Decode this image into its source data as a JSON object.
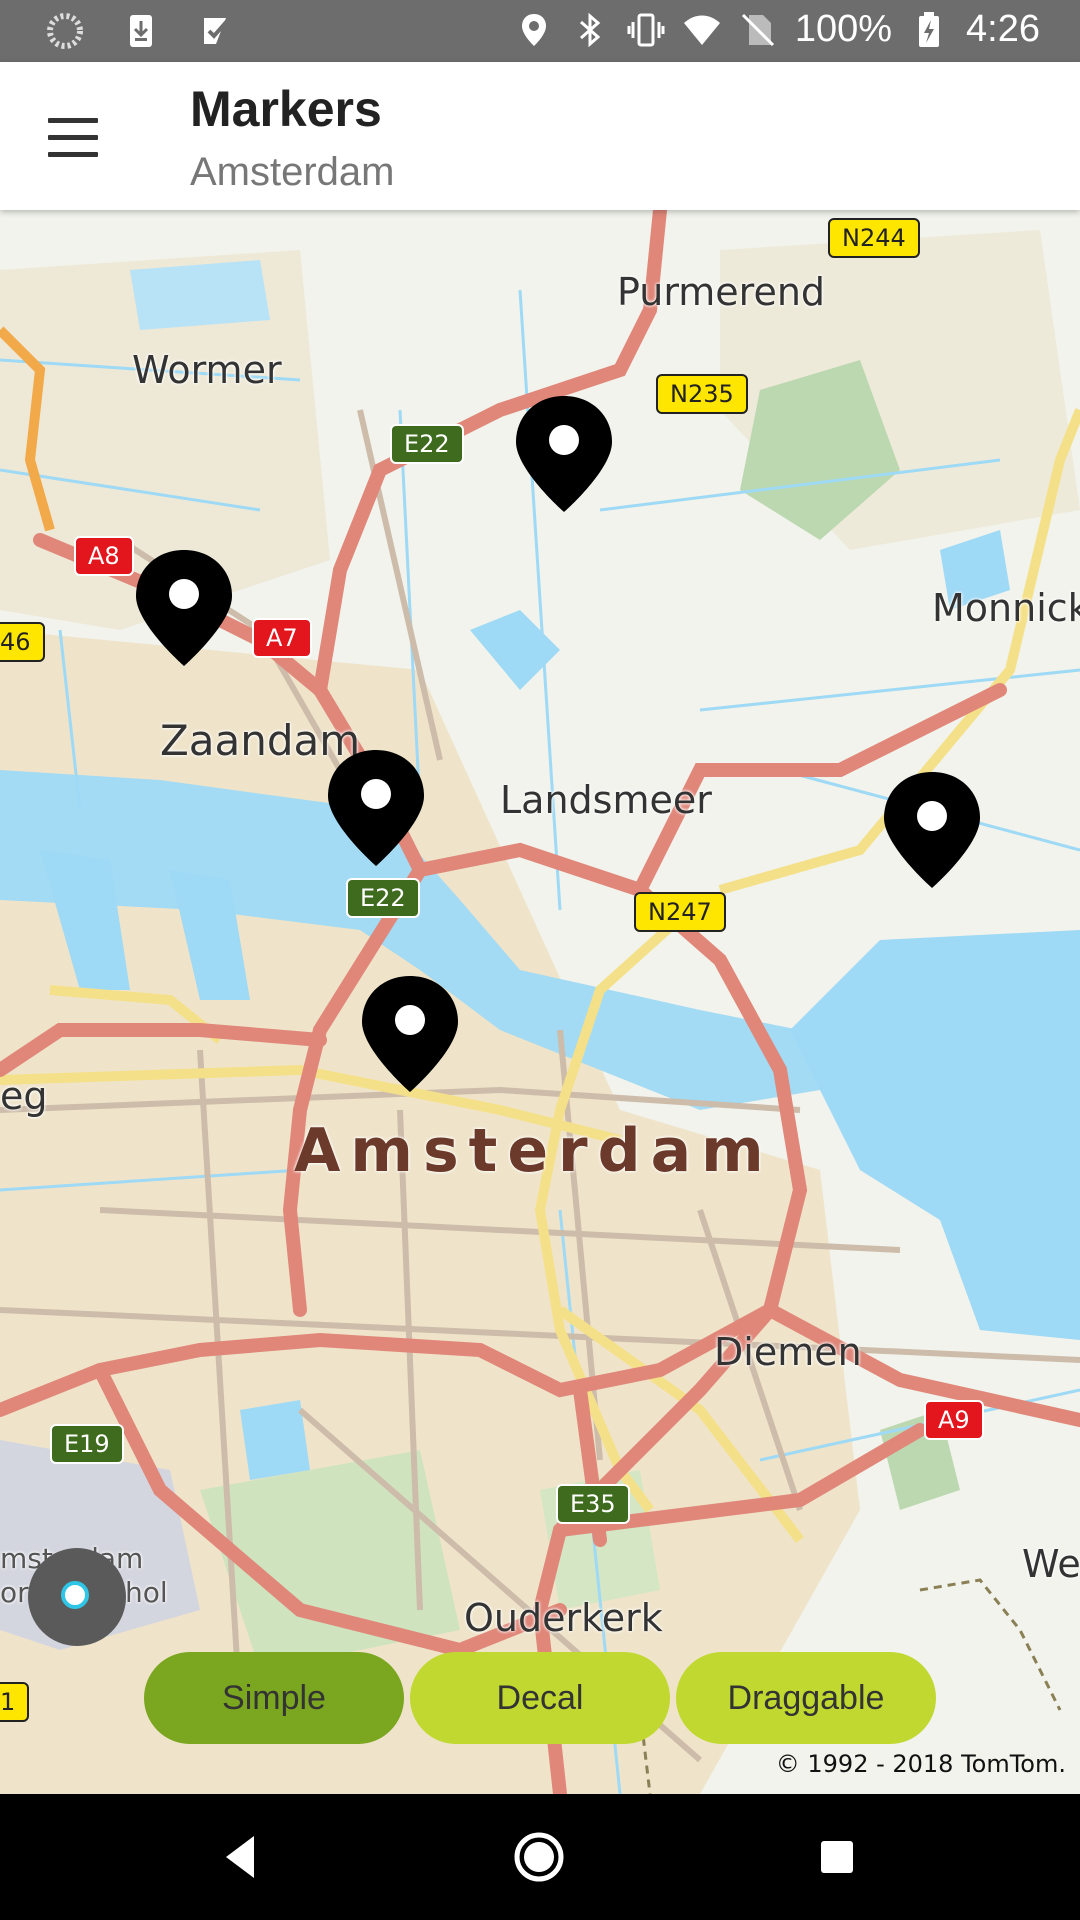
{
  "status_bar": {
    "battery": "100%",
    "time": "4:26",
    "icons": [
      "spinner-icon",
      "download-icon",
      "task-icon",
      "location-icon",
      "bluetooth-icon",
      "vibrate-icon",
      "wifi-icon",
      "no-sim-icon",
      "battery-charging-icon"
    ]
  },
  "app_bar": {
    "title": "Markers",
    "subtitle": "Amsterdam",
    "menu_icon": "hamburger-menu-icon"
  },
  "map": {
    "labels": {
      "purmerend": "Purmerend",
      "wormer": "Wormer",
      "monnickendam": "Monnicke",
      "zaandam": "Zaandam",
      "landsmeer": "Landsmeer",
      "amsterdam": "Amsterdam",
      "diemen": "Diemen",
      "ouderkerk": "Ouderkerk",
      "schiphol_1": "msterdam",
      "schiphol_2": "ort Schiphol",
      "weesp": "Wee",
      "west_edge": "eg"
    },
    "road_shields": {
      "n244": "N244",
      "n235": "N235",
      "e22_north": "E22",
      "a8": "A8",
      "a7": "A7",
      "a46_partial": "46",
      "e22_south": "E22",
      "n247": "N247",
      "a9": "A9",
      "e19": "E19",
      "e35": "E35",
      "edge_1": "1"
    },
    "markers": [
      "marker-1",
      "marker-2",
      "marker-3",
      "marker-4",
      "marker-5"
    ],
    "copyright": "© 1992 - 2018 TomTom."
  },
  "controls": {
    "buttons": [
      {
        "label": "Simple",
        "active": true
      },
      {
        "label": "Decal",
        "active": false
      },
      {
        "label": "Draggable",
        "active": false
      }
    ],
    "my_location_icon": "my-location-icon"
  },
  "nav_bar": {
    "back": "back-icon",
    "home": "home-icon",
    "recents": "recents-icon"
  },
  "colors": {
    "active_button": "#7ba61f",
    "inactive_button": "#c0d82f",
    "primary_road": "#e07a6a",
    "water": "#9ed9f5"
  }
}
